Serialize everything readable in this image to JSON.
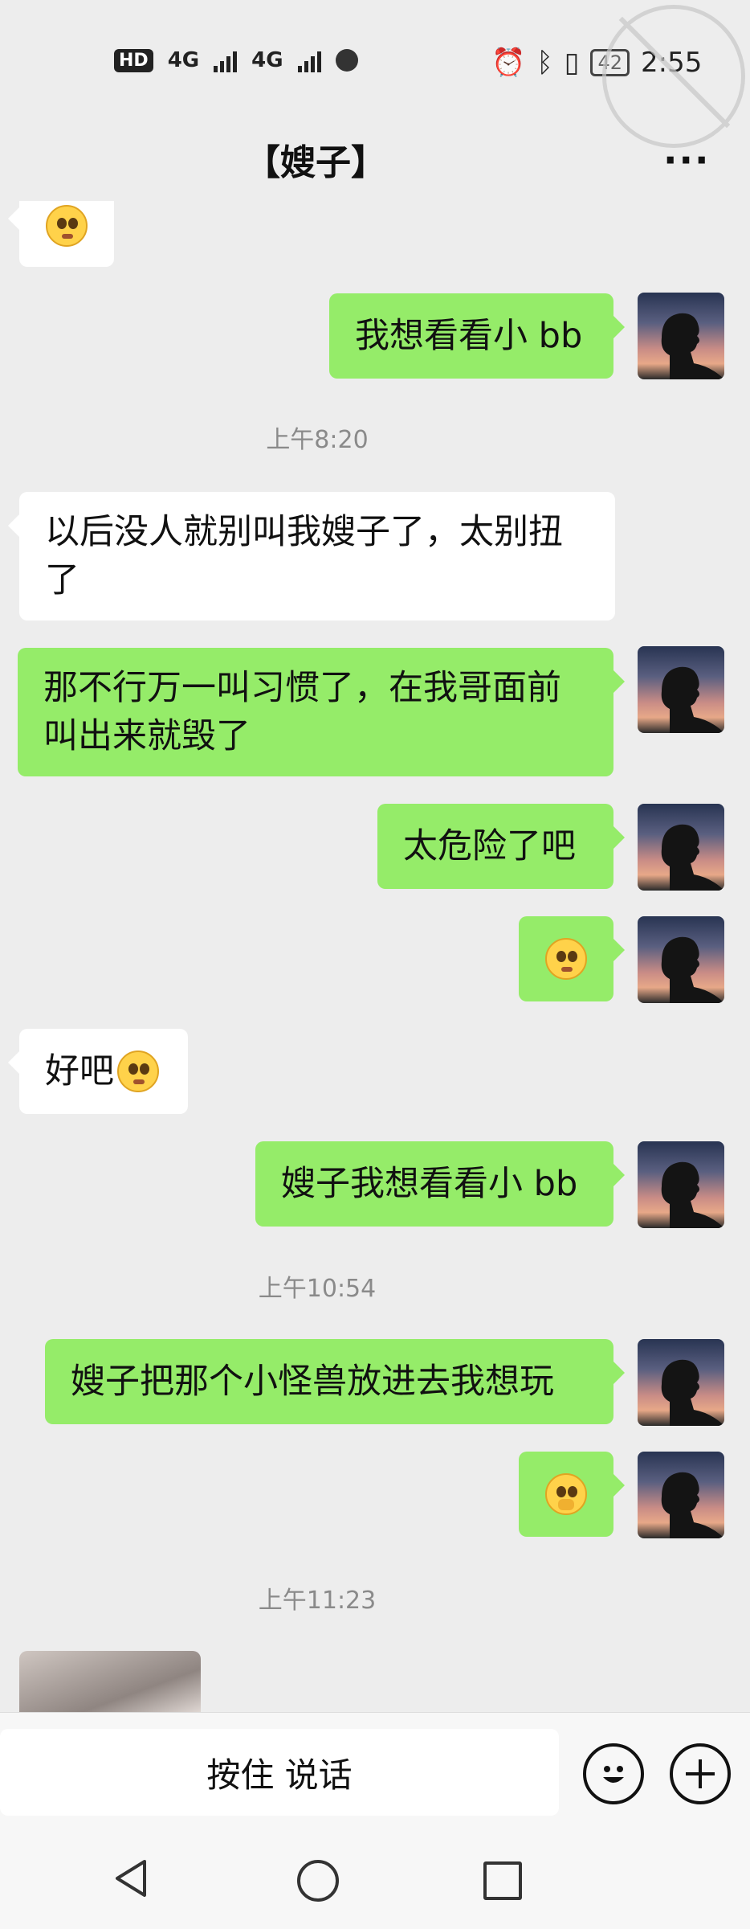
{
  "status_bar": {
    "hd_label": "HD",
    "sim1_label": "4G",
    "sim2_label": "4G",
    "battery": "42",
    "time": "2:55"
  },
  "header": {
    "title": "【嫂子】",
    "more_label": "···"
  },
  "messages": [
    {
      "side": "in",
      "type": "emoji",
      "emoji": "pleading-face"
    },
    {
      "side": "out",
      "text": "我想看看小 bb"
    },
    {
      "type": "time",
      "text": "上午8:20"
    },
    {
      "side": "in",
      "text": "以后没人就别叫我嫂子了，太别扭了"
    },
    {
      "side": "out",
      "text": "那不行万一叫习惯了，在我哥面前叫出来就毁了"
    },
    {
      "side": "out",
      "text": "太危险了吧"
    },
    {
      "side": "out",
      "type": "emoji",
      "emoji": "pleading-face"
    },
    {
      "side": "in",
      "text": "好吧",
      "emoji": "pleading-face"
    },
    {
      "side": "out",
      "text": "嫂子我想看看小 bb"
    },
    {
      "type": "time",
      "text": "上午10:54"
    },
    {
      "side": "out",
      "text": "嫂子把那个小怪兽放进去我想玩"
    },
    {
      "side": "out",
      "type": "emoji",
      "emoji": "face-with-hand-over-mouth"
    },
    {
      "type": "time",
      "text": "上午11:23"
    },
    {
      "side": "in",
      "type": "image"
    }
  ],
  "input_bar": {
    "hold_to_talk_label": "按住 说话",
    "emoji_button": "smiley-icon",
    "more_button": "plus-icon"
  },
  "colors": {
    "background": "#ededed",
    "outgoing_bubble": "#95ec69",
    "incoming_bubble": "#ffffff"
  }
}
